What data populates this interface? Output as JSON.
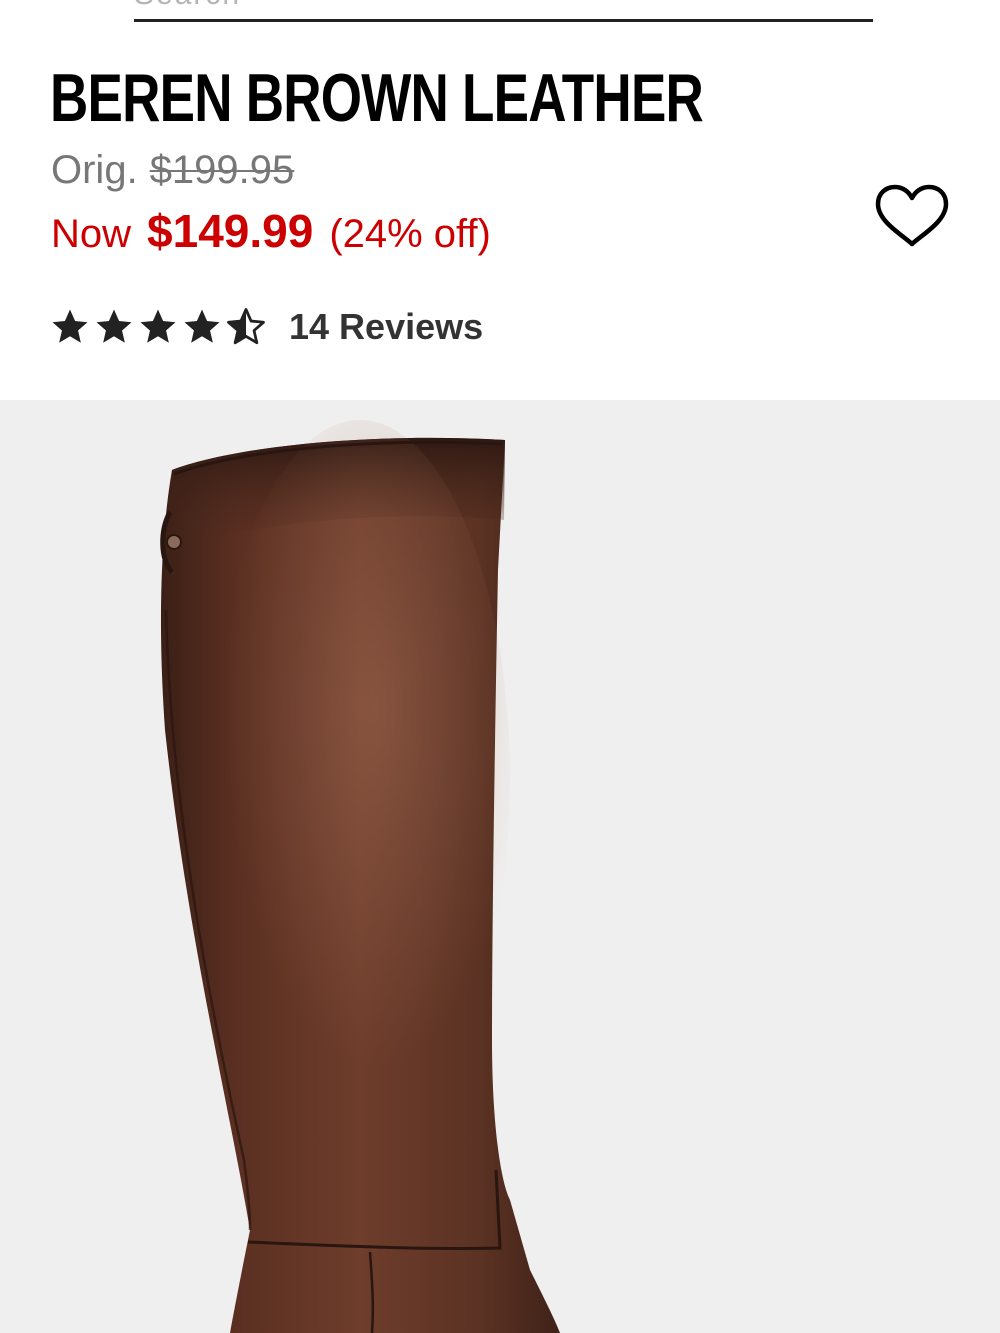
{
  "search": {
    "placeholder": "Search"
  },
  "product": {
    "title": "BEREN BROWN LEATHER",
    "orig_label": "Orig.",
    "orig_price": "$199.95",
    "now_label": "Now",
    "now_price": "$149.99",
    "discount": "(24% off)",
    "rating": 4.5,
    "reviews_label": "14 Reviews",
    "image_alt": "Brown leather knee-high boot"
  },
  "icons": {
    "search": "search-icon",
    "wishlist": "heart-outline-icon",
    "star_full": "star-icon",
    "star_half": "half-star-icon"
  },
  "colors": {
    "sale_red": "#cc0000",
    "original_gray": "#777777",
    "star_dark": "#222222",
    "image_bg": "#efefef",
    "leather_brown": "#5a3122"
  }
}
